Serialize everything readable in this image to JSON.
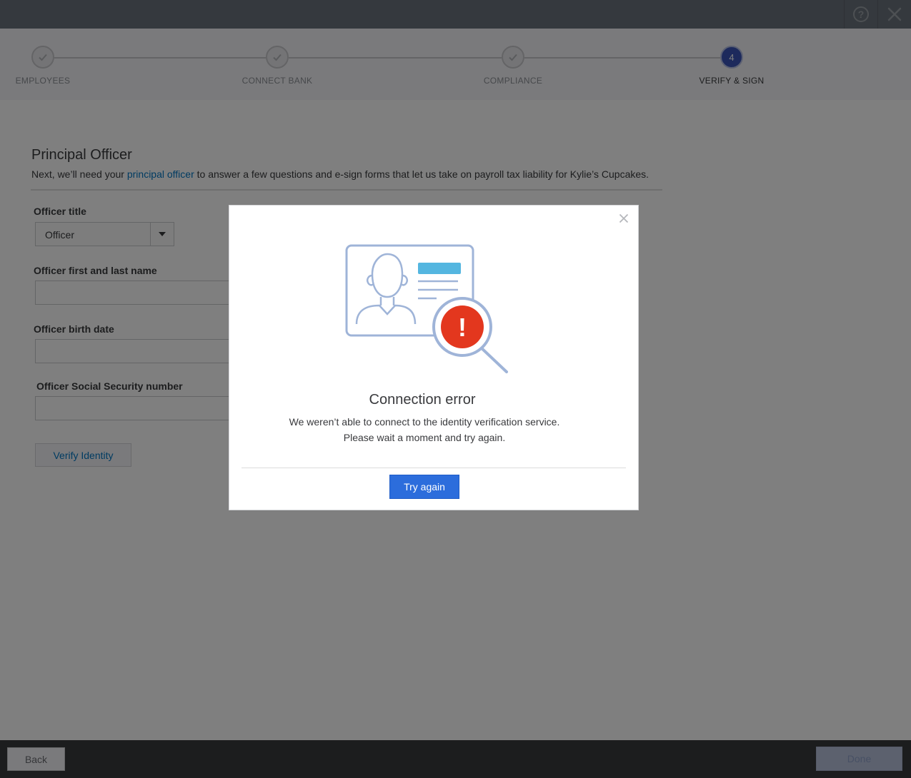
{
  "topbar": {
    "help_icon": "question-circle-icon",
    "close_icon": "close-icon"
  },
  "stepper": {
    "steps": [
      {
        "label": "EMPLOYEES",
        "state": "complete"
      },
      {
        "label": "CONNECT BANK",
        "state": "complete"
      },
      {
        "label": "COMPLIANCE",
        "state": "complete"
      },
      {
        "label": "VERIFY & SIGN",
        "state": "active",
        "number": "4"
      }
    ]
  },
  "form": {
    "title": "Principal Officer",
    "desc_before": "Next, we’ll need your ",
    "desc_link": "principal officer",
    "desc_after": " to answer a few questions and e-sign forms that let us take on payroll tax liability for Kylie’s Cupcakes.",
    "officer_title_label": "Officer title",
    "officer_title_value": "Officer",
    "name_label": "Officer first and last name",
    "birth_label": "Officer birth date",
    "ssn_label": "Officer Social Security number",
    "verify_label": "Verify Identity"
  },
  "footer": {
    "back_label": "Back",
    "done_label": "Done"
  },
  "modal": {
    "title": "Connection error",
    "message_line1": "We weren’t able to connect to the identity verification service.",
    "message_line2": "Please wait a moment and try again.",
    "button_label": "Try again",
    "alert_symbol": "!",
    "colors": {
      "primary": "#2c6ddc",
      "alert": "#e3371e",
      "illustration_line": "#9fb4d8",
      "illustration_accent": "#54b6e0"
    }
  }
}
